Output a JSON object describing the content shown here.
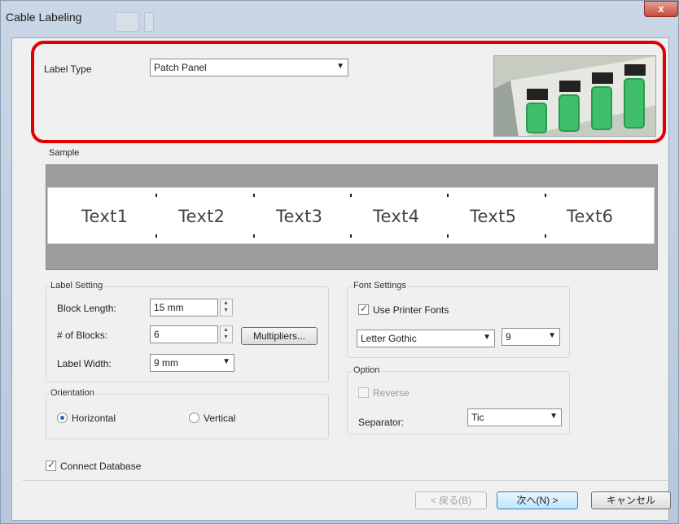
{
  "window": {
    "title": "Cable Labeling",
    "close_glyph": "x"
  },
  "label_type": {
    "label": "Label Type",
    "selected": "Patch Panel"
  },
  "preview": {
    "icon": "patch-panel-preview-image"
  },
  "sample": {
    "label": "Sample",
    "blocks": [
      "Text1",
      "Text2",
      "Text3",
      "Text4",
      "Text5",
      "Text6"
    ]
  },
  "label_setting": {
    "group_label": "Label Setting",
    "block_length_label": "Block Length:",
    "block_length_value": "15 mm",
    "num_blocks_label": "# of Blocks:",
    "num_blocks_value": "6",
    "multipliers_button": "Multipliers...",
    "label_width_label": "Label Width:",
    "label_width_value": "9 mm"
  },
  "orientation": {
    "group_label": "Orientation",
    "horizontal": "Horizontal",
    "vertical": "Vertical",
    "selected": "Horizontal"
  },
  "font_settings": {
    "group_label": "Font Settings",
    "use_printer_fonts": "Use Printer Fonts",
    "use_printer_fonts_checked": true,
    "font_name": "Letter Gothic",
    "font_size": "9"
  },
  "option": {
    "group_label": "Option",
    "reverse": "Reverse",
    "reverse_enabled": false,
    "separator_label": "Separator:",
    "separator_value": "Tic"
  },
  "connect_database": {
    "label": "Connect Database",
    "checked": true
  },
  "footer": {
    "back_button": "< 戻る(B)",
    "next_button": "次へ(N) >",
    "cancel_button": "キャンセル"
  },
  "colors": {
    "highlight": "#e00000",
    "accent": "#2b64b8"
  }
}
